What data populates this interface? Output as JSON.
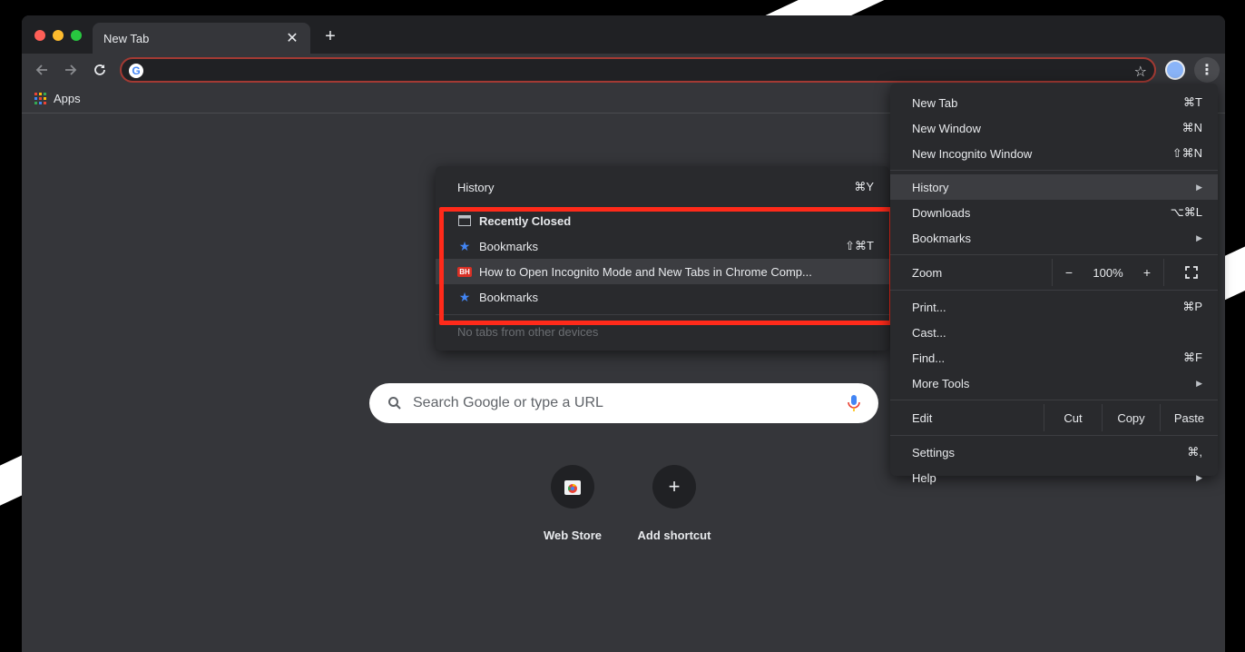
{
  "tab": {
    "title": "New Tab"
  },
  "bookmarks_bar": {
    "apps_label": "Apps"
  },
  "ntp": {
    "search_placeholder": "Search Google or type a URL",
    "shortcuts": [
      {
        "label": "Web Store",
        "icon": "webstore-icon"
      },
      {
        "label": "Add shortcut",
        "icon": "plus-icon"
      }
    ]
  },
  "menu": {
    "items_top": [
      {
        "label": "New Tab",
        "shortcut": "⌘T"
      },
      {
        "label": "New Window",
        "shortcut": "⌘N"
      },
      {
        "label": "New Incognito Window",
        "shortcut": "⇧⌘N"
      }
    ],
    "items_history": [
      {
        "label": "History",
        "submenu": true
      },
      {
        "label": "Downloads",
        "shortcut": "⌥⌘L"
      },
      {
        "label": "Bookmarks",
        "submenu": true
      }
    ],
    "zoom": {
      "label": "Zoom",
      "minus": "−",
      "value": "100%",
      "plus": "+"
    },
    "items_tools": [
      {
        "label": "Print...",
        "shortcut": "⌘P"
      },
      {
        "label": "Cast...",
        "shortcut": ""
      },
      {
        "label": "Find...",
        "shortcut": "⌘F"
      },
      {
        "label": "More Tools",
        "submenu": true
      }
    ],
    "edit": {
      "label": "Edit",
      "cut": "Cut",
      "copy": "Copy",
      "paste": "Paste"
    },
    "items_bottom": [
      {
        "label": "Settings",
        "shortcut": "⌘,"
      },
      {
        "label": "Help",
        "submenu": true
      }
    ]
  },
  "history_submenu": {
    "header": {
      "label": "History",
      "shortcut": "⌘Y"
    },
    "items": [
      {
        "label": "Recently Closed",
        "icon": "window-icon",
        "shortcut": ""
      },
      {
        "label": "Bookmarks",
        "icon": "star-icon",
        "shortcut": "⇧⌘T"
      },
      {
        "label": "How to Open Incognito Mode and New Tabs in Chrome Comp...",
        "icon": "bh-favicon",
        "shortcut": ""
      },
      {
        "label": "Bookmarks",
        "icon": "star-icon",
        "shortcut": ""
      }
    ],
    "footer": "No tabs from other devices",
    "favicon_text": "BH"
  },
  "colors": {
    "highlight": "#ff2a1a",
    "window_bg": "#35363a",
    "menu_bg": "#292a2d",
    "star_blue": "#4285f4"
  }
}
